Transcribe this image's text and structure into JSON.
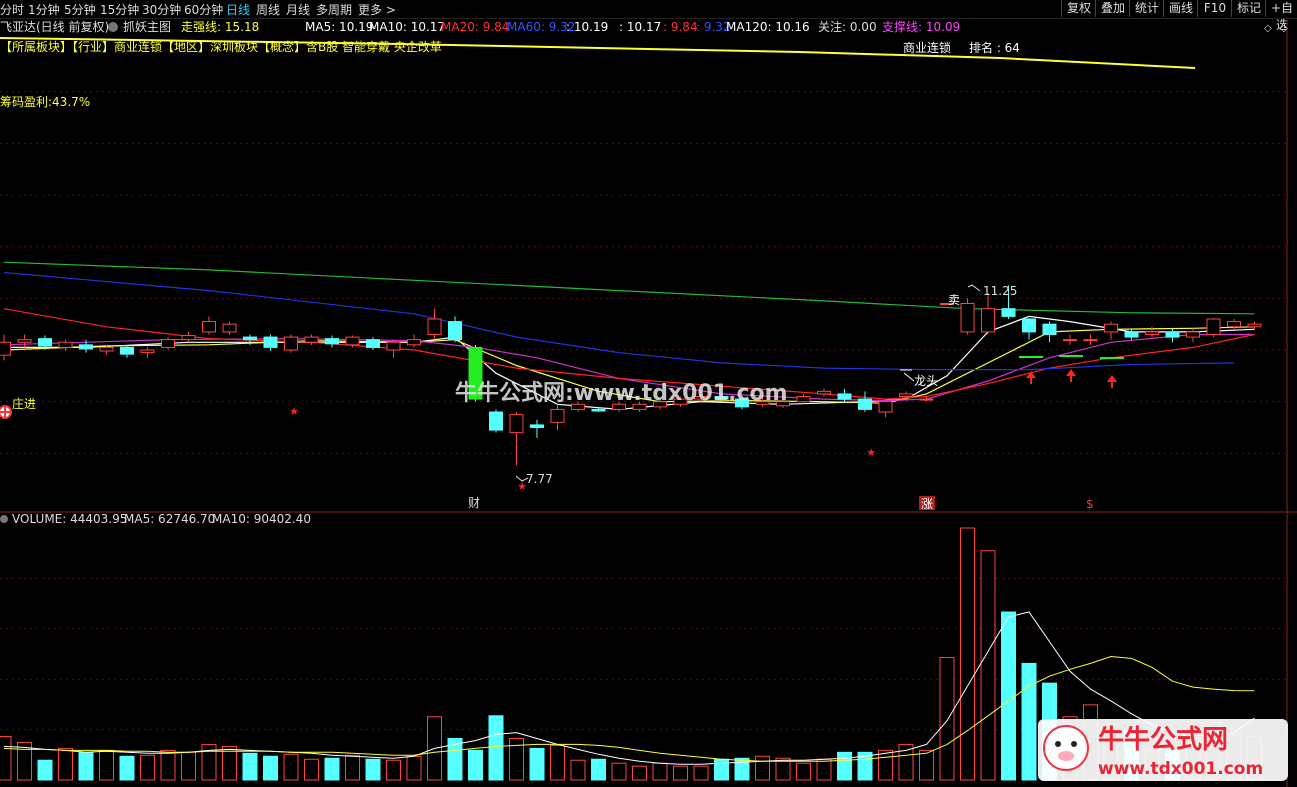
{
  "topbar": {
    "periods": [
      "分时",
      "1分钟",
      "5分钟",
      "15分钟",
      "30分钟",
      "60分钟",
      "日线",
      "周线",
      "月线",
      "多周期",
      "更多"
    ],
    "active_period": "日线",
    "buttons": [
      "复权",
      "叠加",
      "统计",
      "画线",
      "F10",
      "标记",
      "+自选"
    ]
  },
  "info": {
    "stock": "飞亚达(日线 前复权)",
    "indicator": "抓妖主图",
    "strong_line": "走强线: 15.18",
    "ma_values": [
      {
        "text": "MA5: 10.19",
        "color": "#ffffff"
      },
      {
        "text": "MA10: 10.17",
        "color": "#ffffff"
      },
      {
        "text": "MA20: 9.84",
        "color": "#ff3333"
      },
      {
        "text": "MA60: 9.32",
        "color": "#3355ff"
      },
      {
        "text": ": 10.19",
        "color": "#ffffff"
      },
      {
        "text": ": 10.17",
        "color": "#ffffff"
      },
      {
        "text": ": 9.84",
        "color": "#ff3333"
      },
      {
        "text": ": 9.32",
        "color": "#3355ff"
      },
      {
        "text": "MA120: 10.16",
        "color": "#ffffff"
      }
    ],
    "focus": "关注: 0.00",
    "support": "支撑线: 10.09",
    "sector_line": "【所属板块】【行业】商业连锁【地区】深圳板块【概念】含B股 智能穿戴 央企改革",
    "sector_name": "商业连锁",
    "rank": "排名 : 64",
    "chip_profit": "筹码盈利:43.7%"
  },
  "chart_data": {
    "type": "candlestick",
    "price_range": [
      7.0,
      16.0
    ],
    "candles": [
      {
        "o": 9.9,
        "c": 10.15,
        "h": 10.3,
        "l": 9.8
      },
      {
        "o": 10.15,
        "c": 10.2,
        "h": 10.3,
        "l": 10.05
      },
      {
        "o": 10.22,
        "c": 10.08,
        "h": 10.28,
        "l": 10.0
      },
      {
        "o": 10.05,
        "c": 10.15,
        "h": 10.2,
        "l": 9.98
      },
      {
        "o": 10.1,
        "c": 10.02,
        "h": 10.2,
        "l": 9.95
      },
      {
        "o": 9.98,
        "c": 10.05,
        "h": 10.1,
        "l": 9.9
      },
      {
        "o": 10.05,
        "c": 9.92,
        "h": 10.1,
        "l": 9.85
      },
      {
        "o": 9.95,
        "c": 10.0,
        "h": 10.05,
        "l": 9.85
      },
      {
        "o": 10.05,
        "c": 10.2,
        "h": 10.25,
        "l": 10.0
      },
      {
        "o": 10.2,
        "c": 10.28,
        "h": 10.35,
        "l": 10.15
      },
      {
        "o": 10.35,
        "c": 10.55,
        "h": 10.65,
        "l": 10.3
      },
      {
        "o": 10.35,
        "c": 10.5,
        "h": 10.55,
        "l": 10.3
      },
      {
        "o": 10.25,
        "c": 10.2,
        "h": 10.3,
        "l": 10.1
      },
      {
        "o": 10.25,
        "c": 10.05,
        "h": 10.3,
        "l": 9.98
      },
      {
        "o": 10.0,
        "c": 10.25,
        "h": 10.3,
        "l": 9.95
      },
      {
        "o": 10.15,
        "c": 10.25,
        "h": 10.3,
        "l": 10.1
      },
      {
        "o": 10.22,
        "c": 10.12,
        "h": 10.28,
        "l": 10.05
      },
      {
        "o": 10.1,
        "c": 10.25,
        "h": 10.28,
        "l": 10.05
      },
      {
        "o": 10.2,
        "c": 10.05,
        "h": 10.25,
        "l": 10.0
      },
      {
        "o": 10.0,
        "c": 10.15,
        "h": 10.2,
        "l": 9.85
      },
      {
        "o": 10.1,
        "c": 10.2,
        "h": 10.3,
        "l": 10.05
      },
      {
        "o": 10.3,
        "c": 10.6,
        "h": 10.8,
        "l": 10.2
      },
      {
        "o": 10.55,
        "c": 10.2,
        "h": 10.65,
        "l": 10.15
      },
      {
        "o": 10.05,
        "c": 9.05,
        "h": 10.1,
        "l": 9.0
      },
      {
        "o": 8.8,
        "c": 8.45,
        "h": 8.85,
        "l": 8.4
      },
      {
        "o": 8.4,
        "c": 8.75,
        "h": 8.8,
        "l": 7.77
      },
      {
        "o": 8.55,
        "c": 8.5,
        "h": 8.65,
        "l": 8.3
      },
      {
        "o": 8.6,
        "c": 8.85,
        "h": 8.95,
        "l": 8.45
      },
      {
        "o": 8.85,
        "c": 8.95,
        "h": 9.0,
        "l": 8.8
      },
      {
        "o": 8.85,
        "c": 8.82,
        "h": 8.9,
        "l": 8.8
      },
      {
        "o": 8.85,
        "c": 8.95,
        "h": 9.0,
        "l": 8.8
      },
      {
        "o": 8.85,
        "c": 8.95,
        "h": 9.0,
        "l": 8.8
      },
      {
        "o": 8.9,
        "c": 9.0,
        "h": 9.05,
        "l": 8.85
      },
      {
        "o": 8.95,
        "c": 9.05,
        "h": 9.1,
        "l": 8.9
      },
      {
        "o": 9.05,
        "c": 9.1,
        "h": 9.15,
        "l": 9.0
      },
      {
        "o": 9.1,
        "c": 9.05,
        "h": 9.15,
        "l": 9.0
      },
      {
        "o": 9.05,
        "c": 8.9,
        "h": 9.1,
        "l": 8.85
      },
      {
        "o": 8.95,
        "c": 9.0,
        "h": 9.1,
        "l": 8.9
      },
      {
        "o": 8.92,
        "c": 9.0,
        "h": 9.05,
        "l": 8.88
      },
      {
        "o": 9.0,
        "c": 9.1,
        "h": 9.15,
        "l": 8.95
      },
      {
        "o": 9.15,
        "c": 9.2,
        "h": 9.25,
        "l": 9.1
      },
      {
        "o": 9.15,
        "c": 9.05,
        "h": 9.25,
        "l": 9.0
      },
      {
        "o": 9.05,
        "c": 8.85,
        "h": 9.2,
        "l": 8.8
      },
      {
        "o": 8.8,
        "c": 9.0,
        "h": 9.05,
        "l": 8.7
      },
      {
        "o": 9.1,
        "c": 9.15,
        "h": 9.2,
        "l": 9.05
      },
      {
        "o": 9.05,
        "c": 9.05,
        "h": 9.1,
        "l": 9.0
      },
      {
        "o": 10.9,
        "c": 10.9,
        "h": 10.9,
        "l": 10.9
      },
      {
        "o": 10.35,
        "c": 10.9,
        "h": 11.0,
        "l": 10.3
      },
      {
        "o": 10.35,
        "c": 10.8,
        "h": 11.1,
        "l": 10.3
      },
      {
        "o": 10.8,
        "c": 10.65,
        "h": 11.25,
        "l": 10.6
      },
      {
        "o": 10.6,
        "c": 10.35,
        "h": 10.62,
        "l": 10.2
      },
      {
        "o": 10.5,
        "c": 10.3,
        "h": 10.55,
        "l": 10.15
      },
      {
        "o": 10.2,
        "c": 10.2,
        "h": 10.3,
        "l": 10.1
      },
      {
        "o": 10.2,
        "c": 10.2,
        "h": 10.3,
        "l": 10.1
      },
      {
        "o": 10.35,
        "c": 10.5,
        "h": 10.55,
        "l": 10.2
      },
      {
        "o": 10.35,
        "c": 10.25,
        "h": 10.4,
        "l": 10.2
      },
      {
        "o": 10.3,
        "c": 10.35,
        "h": 10.45,
        "l": 10.25
      },
      {
        "o": 10.35,
        "c": 10.25,
        "h": 10.42,
        "l": 10.15
      },
      {
        "o": 10.25,
        "c": 10.35,
        "h": 10.42,
        "l": 10.15
      },
      {
        "o": 10.3,
        "c": 10.6,
        "h": 10.62,
        "l": 10.25
      },
      {
        "o": 10.45,
        "c": 10.55,
        "h": 10.6,
        "l": 10.4
      },
      {
        "o": 10.45,
        "c": 10.5,
        "h": 10.55,
        "l": 10.4
      }
    ],
    "ma_lines": [
      {
        "name": "MA5",
        "color": "#ffffff",
        "values": [
          [
            0,
            10.05
          ],
          [
            4,
            10.05
          ],
          [
            9,
            10.15
          ],
          [
            14,
            10.15
          ],
          [
            20,
            10.15
          ],
          [
            22,
            10.25
          ],
          [
            24,
            9.55
          ],
          [
            27,
            8.95
          ],
          [
            30,
            8.85
          ],
          [
            34,
            9.0
          ],
          [
            38,
            8.95
          ],
          [
            42,
            9.0
          ],
          [
            44,
            9.05
          ],
          [
            46,
            9.5
          ],
          [
            48,
            10.35
          ],
          [
            50,
            10.65
          ],
          [
            52,
            10.55
          ],
          [
            55,
            10.35
          ],
          [
            58,
            10.35
          ],
          [
            61,
            10.4
          ]
        ]
      },
      {
        "name": "MA10",
        "color": "#ffff44",
        "values": [
          [
            0,
            10.0
          ],
          [
            5,
            10.08
          ],
          [
            10,
            10.1
          ],
          [
            15,
            10.18
          ],
          [
            20,
            10.15
          ],
          [
            22,
            10.2
          ],
          [
            25,
            9.7
          ],
          [
            29,
            9.2
          ],
          [
            32,
            9.0
          ],
          [
            36,
            9.02
          ],
          [
            40,
            9.0
          ],
          [
            43,
            8.97
          ],
          [
            45,
            9.15
          ],
          [
            48,
            9.75
          ],
          [
            51,
            10.35
          ],
          [
            54,
            10.4
          ],
          [
            58,
            10.42
          ],
          [
            61,
            10.45
          ]
        ]
      },
      {
        "name": "MA20",
        "color": "#cc33cc",
        "values": [
          [
            0,
            10.1
          ],
          [
            8,
            10.2
          ],
          [
            14,
            10.22
          ],
          [
            20,
            10.18
          ],
          [
            23,
            10.05
          ],
          [
            26,
            9.85
          ],
          [
            30,
            9.45
          ],
          [
            35,
            9.15
          ],
          [
            40,
            9.05
          ],
          [
            43,
            9.02
          ],
          [
            45,
            9.05
          ],
          [
            48,
            9.4
          ],
          [
            51,
            9.85
          ],
          [
            54,
            10.15
          ],
          [
            58,
            10.3
          ],
          [
            61,
            10.3
          ]
        ]
      },
      {
        "name": "MA60",
        "color": "#ff2222",
        "values": [
          [
            0,
            10.8
          ],
          [
            5,
            10.45
          ],
          [
            10,
            10.22
          ],
          [
            15,
            10.15
          ],
          [
            20,
            10.0
          ],
          [
            25,
            9.65
          ],
          [
            30,
            9.45
          ],
          [
            35,
            9.3
          ],
          [
            40,
            9.15
          ],
          [
            43,
            9.05
          ],
          [
            45,
            9.1
          ],
          [
            48,
            9.35
          ],
          [
            51,
            9.65
          ],
          [
            54,
            9.85
          ],
          [
            58,
            10.05
          ],
          [
            61,
            10.3
          ]
        ]
      },
      {
        "name": "MA120",
        "color": "#2233dd",
        "values": [
          [
            0,
            11.5
          ],
          [
            10,
            11.15
          ],
          [
            20,
            10.7
          ],
          [
            25,
            10.25
          ],
          [
            30,
            9.95
          ],
          [
            35,
            9.75
          ],
          [
            40,
            9.65
          ],
          [
            45,
            9.62
          ],
          [
            50,
            9.62
          ],
          [
            55,
            9.72
          ],
          [
            60,
            9.75
          ]
        ]
      },
      {
        "name": "MA250",
        "color": "#22bb33",
        "values": [
          [
            0,
            11.7
          ],
          [
            10,
            11.55
          ],
          [
            20,
            11.35
          ],
          [
            30,
            11.15
          ],
          [
            40,
            10.95
          ],
          [
            47,
            10.8
          ],
          [
            55,
            10.72
          ],
          [
            61,
            10.7
          ]
        ]
      }
    ],
    "annotations": {
      "high_label": "11.25",
      "low_label": "7.77",
      "sell_label": "卖",
      "dragon_label": "龙头",
      "entry_label": "庄进",
      "cai_label": "财",
      "zhang_label": "涨",
      "dollar_label": "$"
    },
    "volume": {
      "label": "VOLUME: 44403.95",
      "ma5_label": "MA5: 62746.70",
      "ma10_label": "MA10: 90402.40",
      "max": 255000,
      "values": [
        44000,
        38000,
        20000,
        32000,
        28000,
        30000,
        24000,
        25000,
        30000,
        28000,
        36000,
        34000,
        27000,
        24000,
        26000,
        21000,
        22000,
        25000,
        21000,
        20000,
        24000,
        64000,
        42000,
        30000,
        65000,
        42000,
        32000,
        35000,
        20000,
        21000,
        17000,
        14000,
        17000,
        14000,
        14000,
        21000,
        22000,
        24000,
        22000,
        17000,
        21000,
        28000,
        28000,
        30000,
        36000,
        30000,
        124000,
        255000,
        232000,
        170000,
        118000,
        98000,
        64000,
        76000,
        50000,
        50000,
        30000,
        30000,
        42000,
        58000,
        46000,
        44400
      ],
      "ma5": [
        34000,
        33000,
        31000,
        30000,
        28000,
        29000,
        28000,
        27000,
        27000,
        28000,
        30000,
        31000,
        30000,
        29000,
        28000,
        27000,
        25000,
        24000,
        23000,
        22000,
        24000,
        32000,
        36000,
        40000,
        46000,
        48000,
        42000,
        36000,
        31000,
        26000,
        22000,
        19000,
        17000,
        16000,
        16000,
        17000,
        18000,
        19000,
        20000,
        20000,
        21000,
        22000,
        24000,
        27000,
        30000,
        36000,
        60000,
        95000,
        130000,
        165000,
        170000,
        140000,
        110000,
        92000,
        80000,
        67000,
        56000,
        48000,
        45000,
        46000,
        48000,
        62700
      ],
      "ma10": [
        32000,
        31000,
        31000,
        30000,
        30000,
        30000,
        29000,
        29000,
        28000,
        28000,
        29000,
        29000,
        29000,
        29000,
        28000,
        28000,
        28000,
        27000,
        26000,
        25000,
        25000,
        28000,
        30000,
        32000,
        34000,
        35000,
        36000,
        36000,
        36000,
        35000,
        33000,
        30000,
        27000,
        25000,
        23000,
        21000,
        20000,
        19000,
        19000,
        19000,
        19000,
        20000,
        21000,
        23000,
        25000,
        27000,
        36000,
        50000,
        65000,
        80000,
        95000,
        105000,
        112000,
        118000,
        125000,
        123000,
        114000,
        100000,
        94000,
        92000,
        90500,
        90400
      ]
    }
  },
  "watermark": {
    "text": "牛牛公式网:www.tdx001.com",
    "logo_text": "牛牛公式网",
    "logo_url": "www.tdx001.com"
  }
}
